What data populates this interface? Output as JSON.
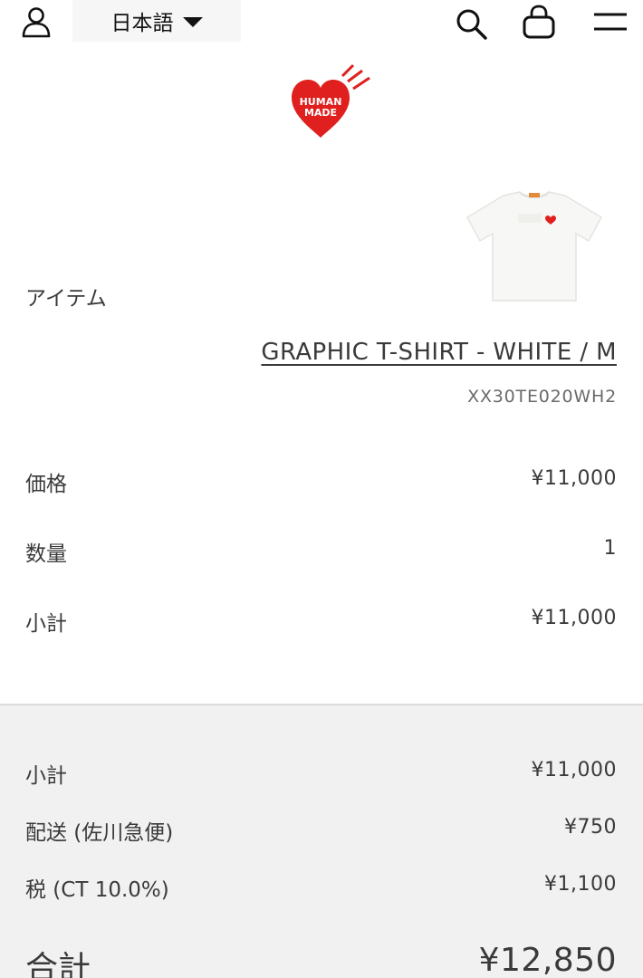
{
  "header": {
    "language": "日本語",
    "icons": [
      "user-icon",
      "search-icon",
      "shopping-bag-icon",
      "menu-icon"
    ]
  },
  "brand": {
    "logo_line1": "HUMAN",
    "logo_line2": "MADE",
    "logo_color": "#e0201e"
  },
  "item": {
    "section_label": "アイテム",
    "product_name": "GRAPHIC T-SHIRT - WHITE / M",
    "sku": "XX30TE020WH2",
    "price_label": "価格",
    "price": "¥11,000",
    "quantity_label": "数量",
    "quantity": "1",
    "subtotal_label": "小計",
    "subtotal": "¥11,000"
  },
  "summary": {
    "subtotal_label": "小計",
    "subtotal": "¥11,000",
    "shipping_label": "配送 (佐川急便)",
    "shipping": "¥750",
    "tax_label": "税 (CT 10.0%)",
    "tax": "¥1,100",
    "total_label": "合計",
    "total": "¥12,850"
  },
  "colors": {
    "text": "#3a3a3a",
    "summary_background": "#f1f1f2",
    "language_background": "#f6f6f6"
  }
}
